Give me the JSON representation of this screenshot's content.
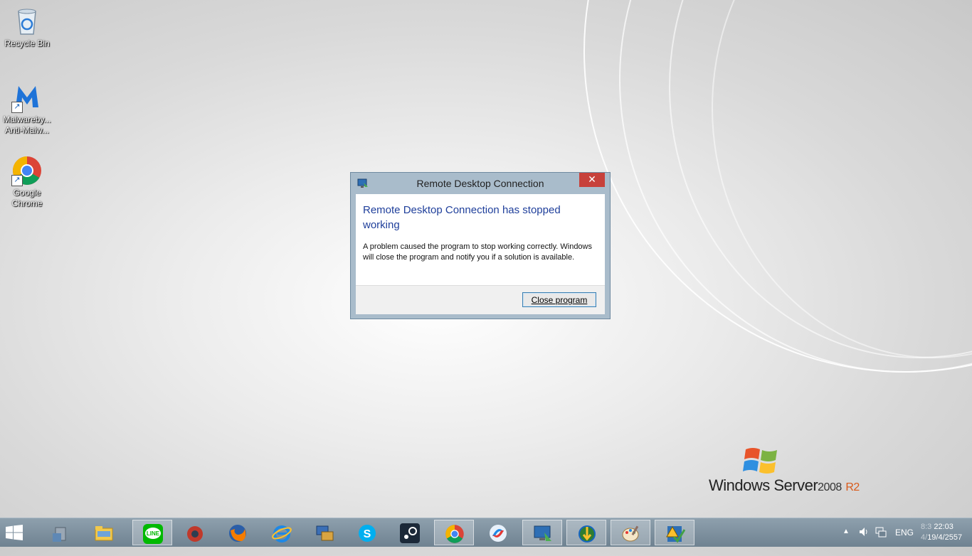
{
  "desktop": {
    "icons": [
      {
        "label_1": "Recycle Bin",
        "label_2": "",
        "icon": "recycle-bin-icon"
      },
      {
        "label_1": "Malwareby...",
        "label_2": "Anti-Malw...",
        "icon": "malwarebytes-icon"
      },
      {
        "label_1": "Google",
        "label_2": "Chrome",
        "icon": "chrome-icon"
      }
    ],
    "branding": {
      "main": "Windows Server",
      "version": "2008",
      "edition": "R2"
    }
  },
  "dialog": {
    "title": "Remote Desktop Connection",
    "close_glyph": "✕",
    "heading": "Remote Desktop Connection has stopped working",
    "message": "A problem caused the program to stop working correctly. Windows will close the program and notify you if a solution is available.",
    "button_label": "Close program"
  },
  "taskbar": {
    "apps": [
      {
        "name": "server-manager-icon"
      },
      {
        "name": "file-explorer-icon"
      },
      {
        "name": "line-icon",
        "text": "LINE"
      },
      {
        "name": "app-red-icon"
      },
      {
        "name": "firefox-icon"
      },
      {
        "name": "internet-explorer-icon"
      },
      {
        "name": "connection-app-icon"
      },
      {
        "name": "skype-icon"
      },
      {
        "name": "steam-icon"
      },
      {
        "name": "chrome-icon"
      },
      {
        "name": "swirl-app-icon"
      },
      {
        "name": "remote-desktop-icon"
      },
      {
        "name": "globe-download-icon"
      },
      {
        "name": "paint-icon"
      },
      {
        "name": "warning-checklist-icon"
      }
    ],
    "tray": {
      "language": "ENG",
      "time": "22:03",
      "time_hidden": "8:3",
      "date": "19/4/2557",
      "date_hidden": "4/"
    }
  },
  "colors": {
    "accent_title": "#1f3f9b",
    "close_red": "#c7413b",
    "taskbar": "#7c8e9c"
  }
}
